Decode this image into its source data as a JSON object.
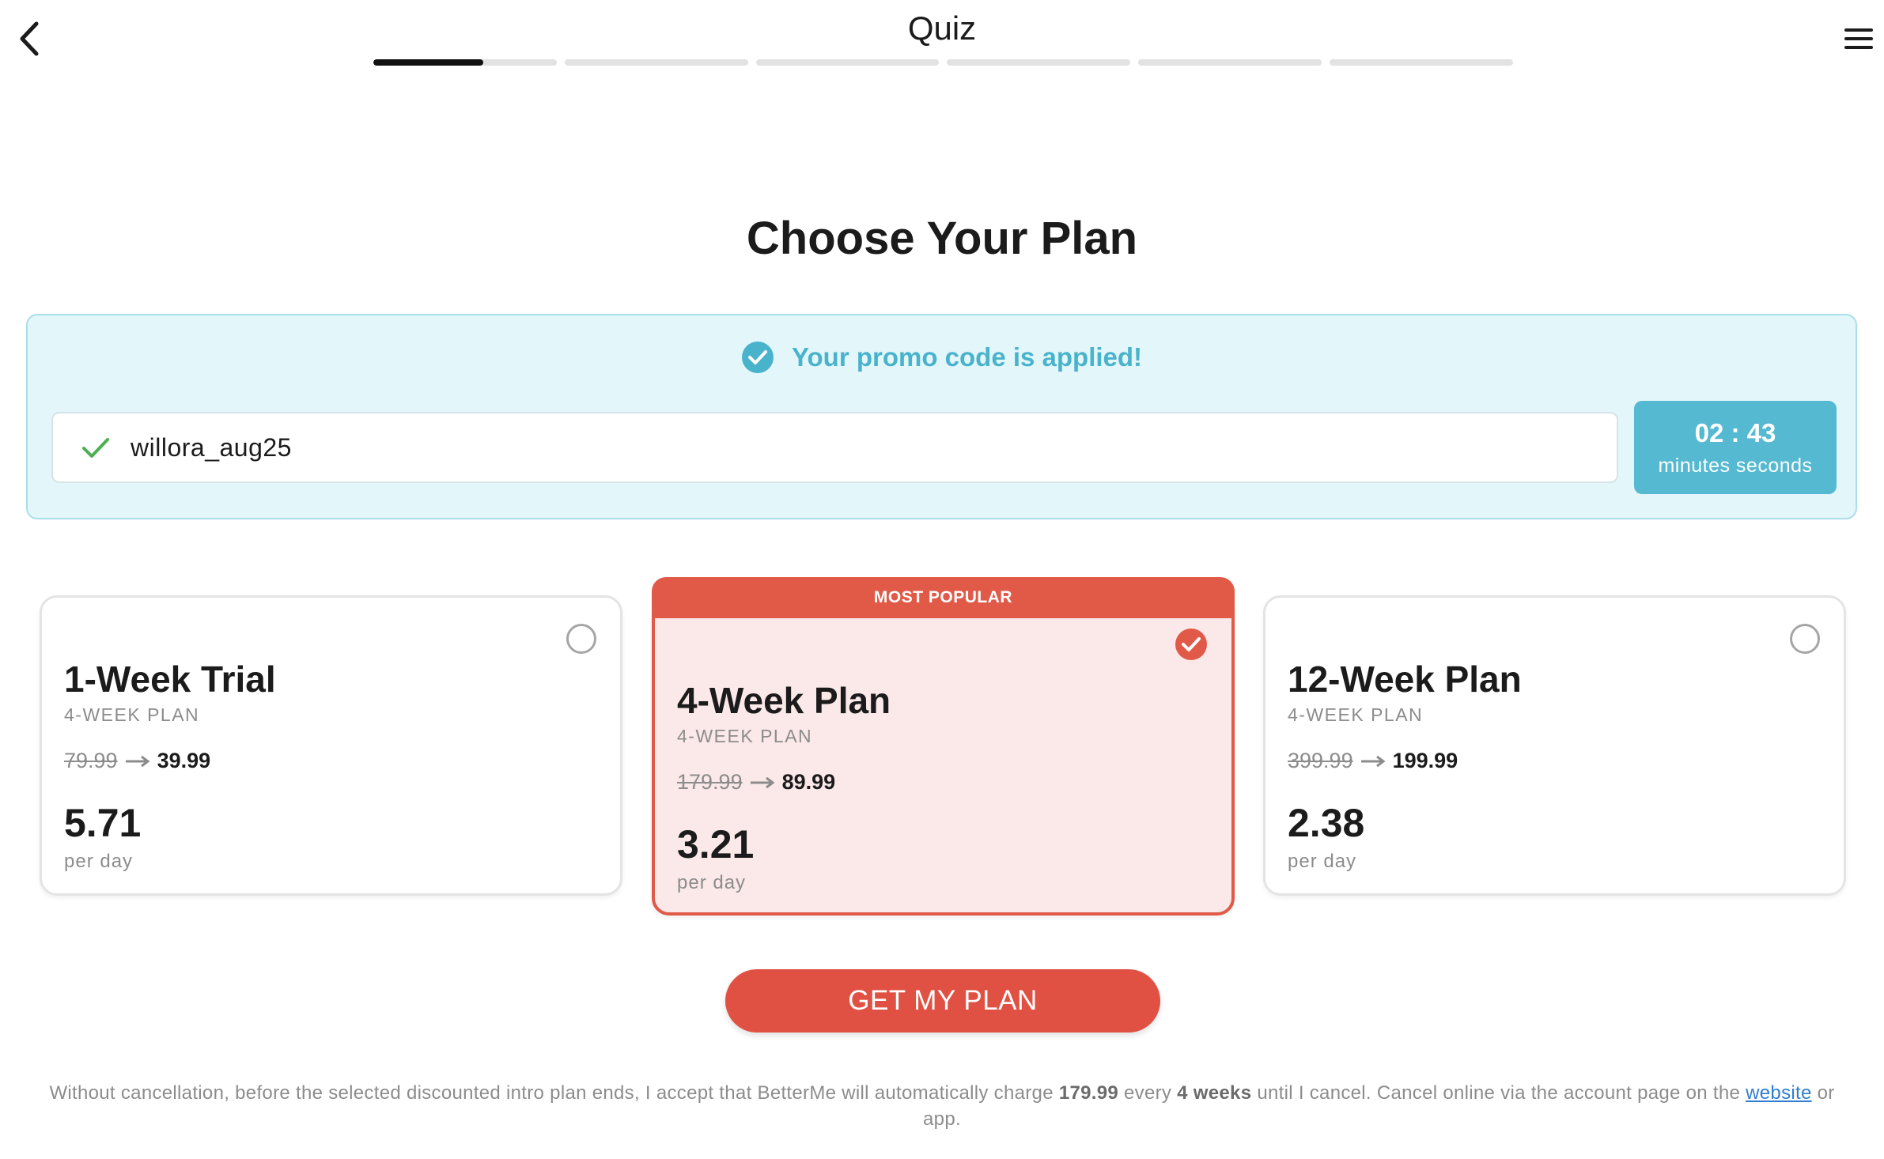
{
  "header": {
    "title": "Quiz",
    "progress": {
      "segments": 6,
      "current_segment_fill": 0.6
    }
  },
  "main": {
    "title": "Choose Your Plan",
    "promo": {
      "status_text": "Your promo code is applied!",
      "code": "willora_aug25",
      "timer_value": "02 : 43",
      "timer_units": "minutes seconds"
    },
    "plans": [
      {
        "name": "1-Week Trial",
        "subtitle": "4-WEEK PLAN",
        "old_price": "79.99",
        "new_price": "39.99",
        "daily_price": "5.71",
        "per_label": "per day",
        "selected": false
      },
      {
        "name": "4-Week Plan",
        "subtitle": "4-WEEK PLAN",
        "old_price": "179.99",
        "new_price": "89.99",
        "daily_price": "3.21",
        "per_label": "per day",
        "selected": true,
        "badge": "MOST POPULAR"
      },
      {
        "name": "12-Week Plan",
        "subtitle": "4-WEEK PLAN",
        "old_price": "399.99",
        "new_price": "199.99",
        "daily_price": "2.38",
        "per_label": "per day",
        "selected": false
      }
    ],
    "cta_label": "GET MY PLAN"
  },
  "disclaimer": {
    "part1": "Without cancellation, before the selected discounted intro plan ends, I accept that BetterMe will automatically charge ",
    "amount": "179.99",
    "part2": " every ",
    "period": "4 weeks",
    "part3": " until I cancel. Cancel online via the account page on the ",
    "link_text": "website",
    "part4": " or app."
  },
  "colors": {
    "accent": "#e15a48",
    "promo_text": "#49b3cc",
    "timer_bg": "#55b9d2",
    "promo_bg": "#e3f6fa",
    "selected_card_bg": "#fbe8e8",
    "check_green": "#4caf50"
  },
  "icons": {
    "back": "chevron-left-icon",
    "menu": "hamburger-menu-icon",
    "promo_status": "check-circle-icon",
    "promo_input": "checkmark-icon",
    "selected": "check-circle-icon",
    "unselected": "radio-empty-icon",
    "price_arrow": "arrow-right-icon"
  }
}
